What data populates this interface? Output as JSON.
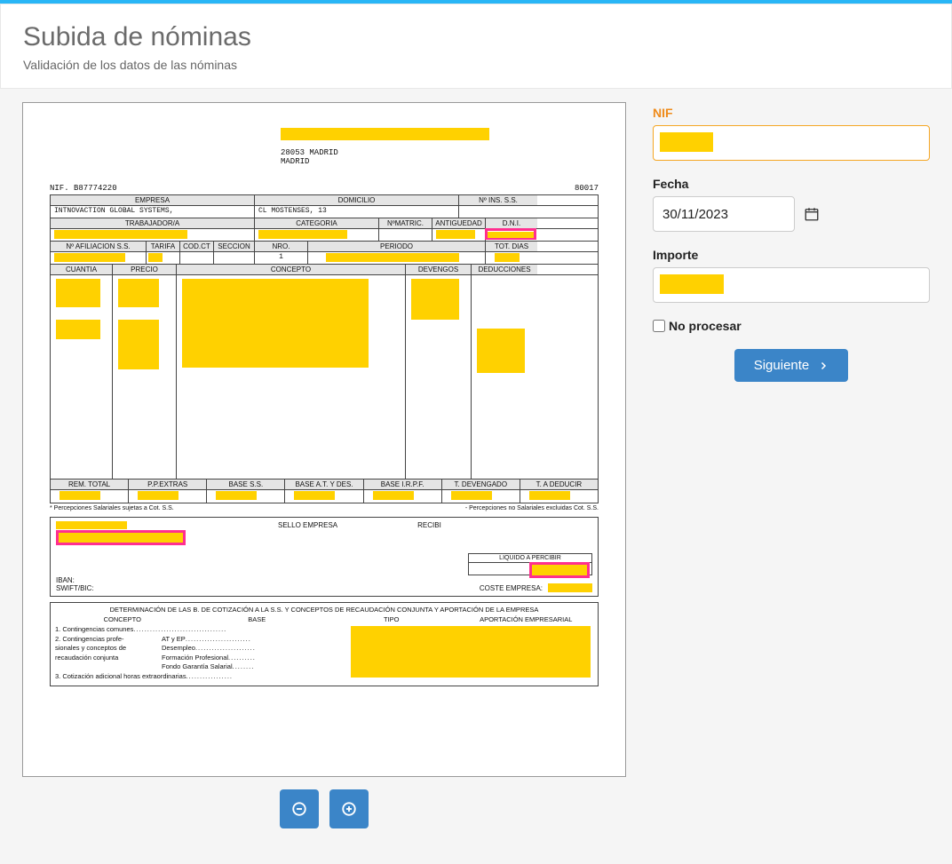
{
  "header": {
    "title": "Subida de nóminas",
    "subtitle": "Validación de los datos de las nóminas"
  },
  "form": {
    "nif_label": "NIF",
    "fecha_label": "Fecha",
    "fecha_value": "30/11/2023",
    "importe_label": "Importe",
    "no_procesar_label": "No procesar",
    "next_label": "Siguiente"
  },
  "controls": {
    "minus": "−",
    "plus": "+"
  },
  "doc": {
    "addr_zip_city": "28053  MADRID",
    "addr_city2": "MADRID",
    "nif_line": "NIF. B87774220",
    "nif_right": "80017",
    "row1_empresa": "EMPRESA",
    "row1_domicilio": "DOMICILIO",
    "row1_ins": "Nº INS. S.S.",
    "empresa_val": "INTNOVACTION GLOBAL SYSTEMS,",
    "domicilio_val": "CL MOSTENSES, 13",
    "row2_trab": "TRABAJADOR/A",
    "row2_cat": "CATEGORIA",
    "row2_matric": "NºMATRIC.",
    "row2_antig": "ANTIGUEDAD",
    "row2_dni": "D.N.I.",
    "row3_afil": "Nº AFILIACION  S.S.",
    "row3_tarifa": "TARIFA",
    "row3_codct": "COD.CT",
    "row3_seccion": "SECCION",
    "row3_nro": "NRO.",
    "row3_periodo": "PERIODO",
    "row3_totdias": "TOT. DIAS",
    "nro_val": "1",
    "row4_cuantia": "CUANTIA",
    "row4_precio": "PRECIO",
    "row4_concepto": "CONCEPTO",
    "row4_devengos": "DEVENGOS",
    "row4_deducciones": "DEDUCCIONES",
    "tot_remtotal": "REM. TOTAL",
    "tot_ppextras": "P.P.EXTRAS",
    "tot_basess": "BASE S.S.",
    "tot_baseat": "BASE A.T. Y DES.",
    "tot_baseirpf": "BASE I.R.P.F.",
    "tot_tdevengado": "T. DEVENGADO",
    "tot_tadeducir": "T.  A DEDUCIR",
    "percep_left": "* Percepciones Salariales  sujetas a Cot. S.S.",
    "percep_right": "- Percepciones no Salariales excluidas Cot. S.S.",
    "sello_empresa": "SELLO EMPRESA",
    "recibi": "RECIBI",
    "liquido": "LIQUIDO A PERCIBIR",
    "iban": "IBAN:",
    "swift": "SWIFT/BIC:",
    "coste_empresa": "COSTE EMPRESA:",
    "determ_title": "DETERMINACIÓN DE LAS B. DE COTIZACIÓN A LA S.S. Y CONCEPTOS DE RECAUDACIÓN CONJUNTA Y APORTACIÓN DE LA EMPRESA",
    "determ_concepto": "CONCEPTO",
    "determ_base": "BASE",
    "determ_tipo": "TIPO",
    "determ_aport": "APORTACIÓN EMPRESARIAL",
    "determ_l1": "1. Contingencias comunes",
    "determ_l2": "2. Contingencias profe-",
    "determ_l2b": "sionales y conceptos de",
    "determ_l2c": "recaudación conjunta",
    "determ_sub1": "AT y EP",
    "determ_sub2": "Desempleo",
    "determ_sub3": "Formación Profesional",
    "determ_sub4": "Fondo Garantía Salarial",
    "determ_l3": "3. Cotización adicional horas extraordinarias"
  }
}
